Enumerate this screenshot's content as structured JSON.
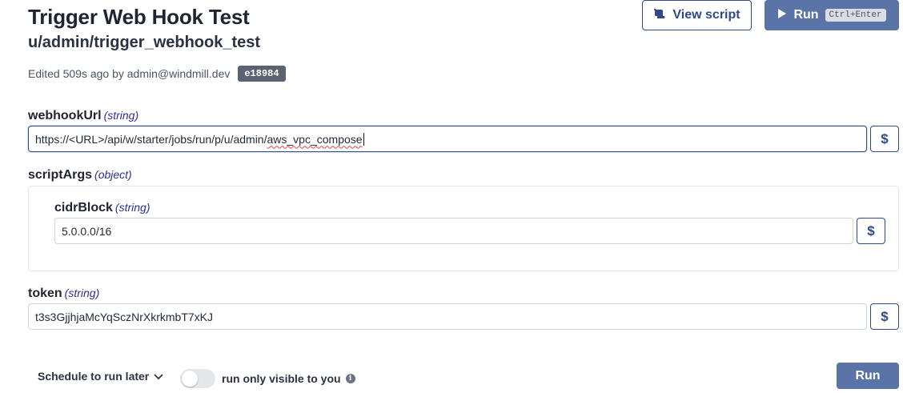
{
  "header": {
    "title": "Trigger Web Hook Test",
    "path": "u/admin/trigger_webhook_test",
    "edited_text": "Edited 509s ago by admin@windmill.dev",
    "hash": "e18984"
  },
  "toolbar": {
    "view_script_label": "View script",
    "run_label": "Run",
    "run_shortcut": "Ctrl+Enter"
  },
  "form": {
    "webhookUrl": {
      "name": "webhookUrl",
      "type": "(string)",
      "value_prefix": "https://<URL>/api/w/starter/jobs/run/p/u/admin/",
      "value_misspelled": "aws_vpc_compose"
    },
    "scriptArgs": {
      "name": "scriptArgs",
      "type": "(object)",
      "cidrBlock": {
        "name": "cidrBlock",
        "type": "(string)",
        "value": "5.0.0.0/16"
      }
    },
    "token": {
      "name": "token",
      "type": "(string)",
      "value": "t3s3GjjhjaMcYqSczNrXkrkmbT7xKJ"
    },
    "dollar_label": "$"
  },
  "footer": {
    "schedule_label": "Schedule to run later",
    "visible_label": "run only visible to you",
    "info_glyph": "i",
    "run_label": "Run",
    "toggle_on": false
  },
  "colors": {
    "accent": "#2f4a85",
    "run_button": "#5b74a8",
    "badge": "#5b6373",
    "type_hint": "#2d2e9a"
  }
}
